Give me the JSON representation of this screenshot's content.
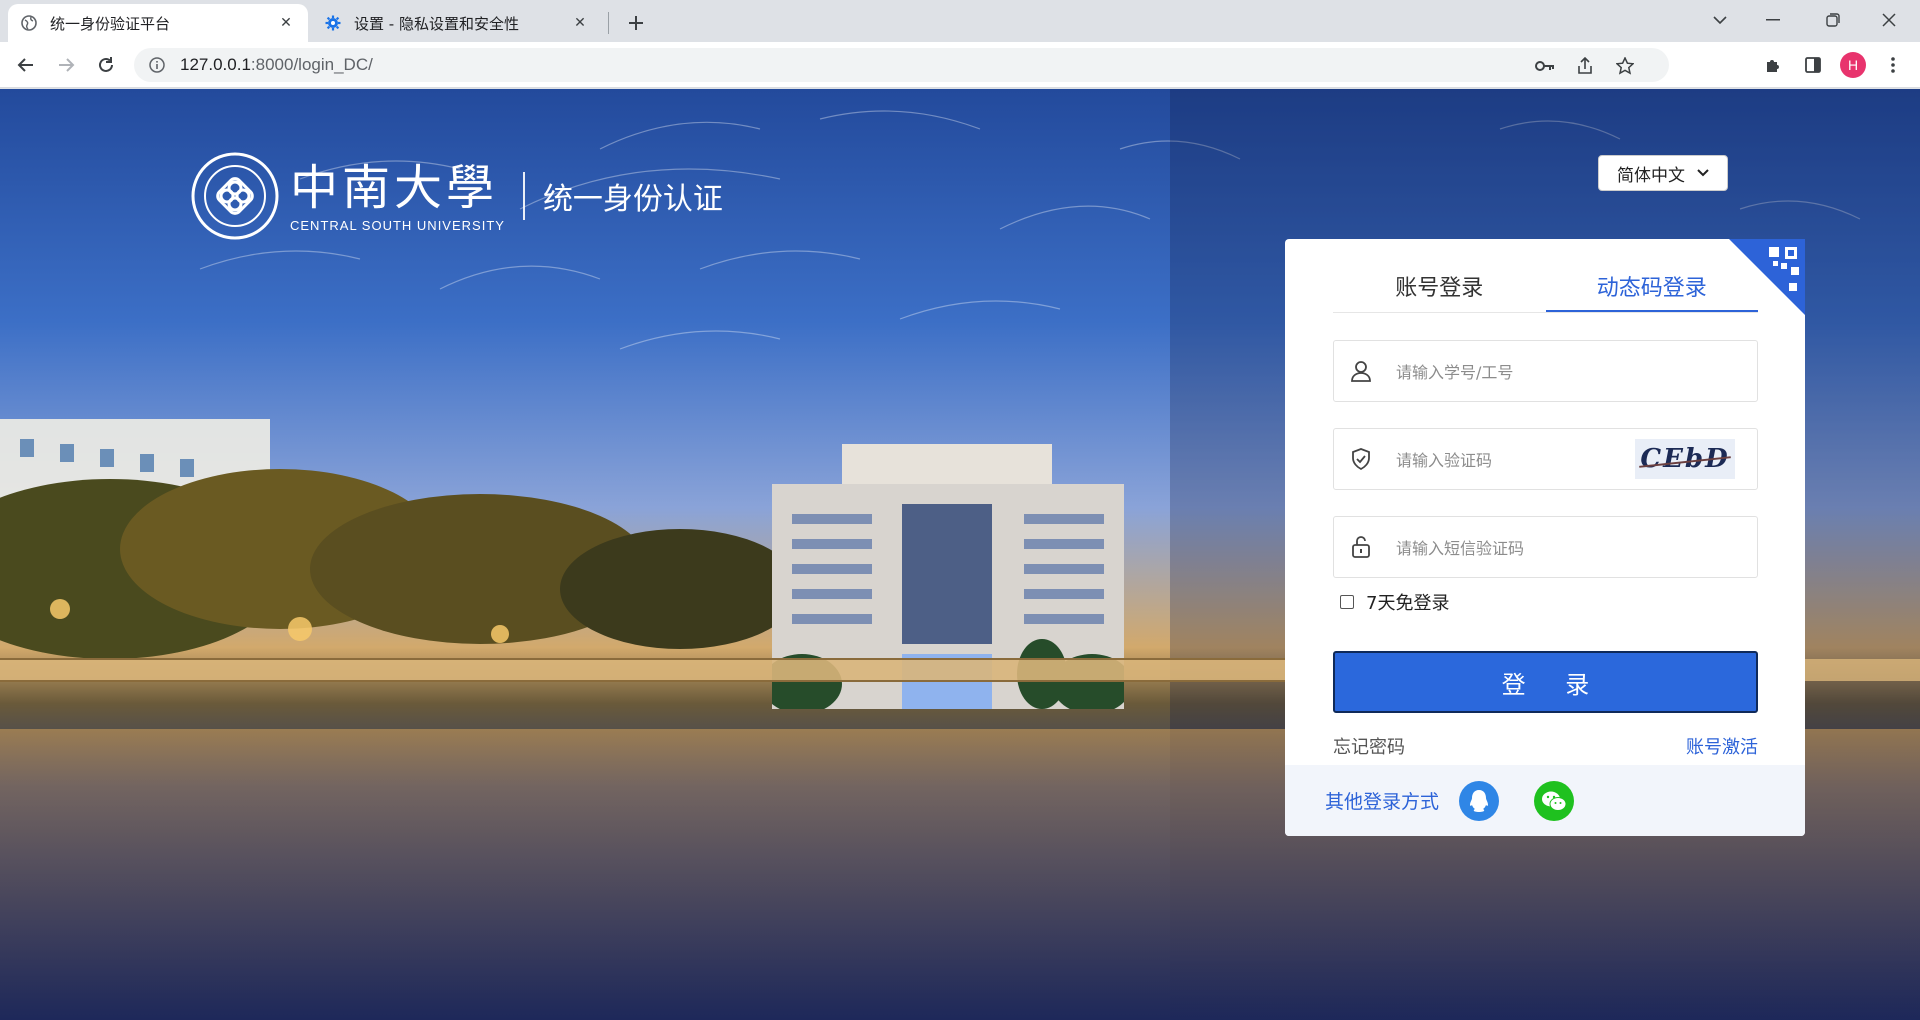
{
  "browser": {
    "tabs": [
      {
        "title": "统一身份验证平台",
        "active": true,
        "icon": "globe-icon"
      },
      {
        "title": "设置 - 隐私设置和安全性",
        "active": false,
        "icon": "settings-gear-icon"
      }
    ],
    "url_host": "127.0.0.1",
    "url_rest": ":8000/login_DC/",
    "profile_initial": "H"
  },
  "header": {
    "university_cn": "中南大學",
    "university_en": "CENTRAL SOUTH UNIVERSITY",
    "system_title": "统一身份认证",
    "language": "简体中文"
  },
  "login": {
    "tabs": [
      "账号登录",
      "动态码登录"
    ],
    "active_tab": 1,
    "username_placeholder": "请输入学号/工号",
    "captcha_placeholder": "请输入验证码",
    "captcha_text": "CEbD",
    "sms_placeholder": "请输入短信验证码",
    "remember_label": "7天免登录",
    "submit_label": "登 录",
    "forgot_label": "忘记密码",
    "activate_label": "账号激活",
    "other_label": "其他登录方式"
  },
  "colors": {
    "accent": "#2b68dc",
    "qq": "#2f86e6",
    "wechat": "#1fc11f"
  }
}
